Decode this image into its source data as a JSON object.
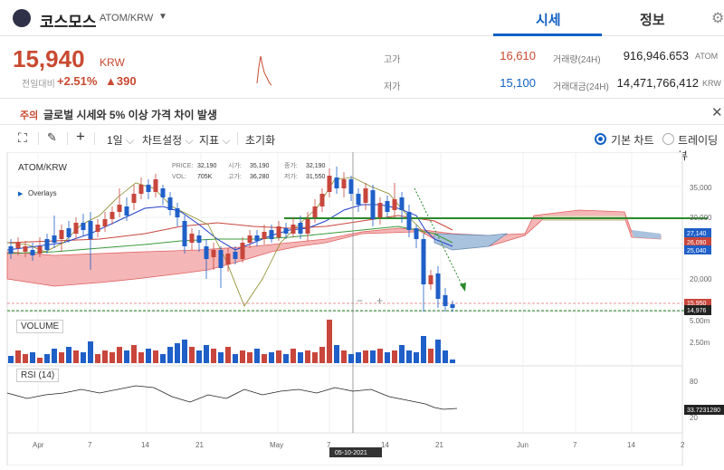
{
  "header": {
    "coin_name": "코스모스",
    "pair": "ATOM/KRW",
    "tabs": [
      "시세",
      "정보"
    ]
  },
  "summary": {
    "price": "15,940",
    "unit": "KRW",
    "change_label": "전일대비",
    "change_rate": "+2.51%",
    "change_amount": "▲390",
    "high_label": "고가",
    "high": "16,610",
    "low_label": "저가",
    "low": "15,100",
    "volume_label": "거래량(24H)",
    "volume": "916,946.653",
    "volume_unit": "ATOM",
    "value_label": "거래대금(24H)",
    "value": "14,471,766,412",
    "value_unit": "KRW"
  },
  "notice": {
    "tag": "주의",
    "text": "글로벌 시세와 5% 이상 가격 차이 발생"
  },
  "toolbar": {
    "interval": "1일",
    "chart_settings": "차트설정",
    "indicators": "지표",
    "reset": "초기화",
    "basic_chart": "기본 차트",
    "trading_view": "트레이딩뷰"
  },
  "chart": {
    "pair": "ATOM/KRW",
    "overlays": "Overlays",
    "ohlc": {
      "price_label": "PRICE:",
      "price": "32,190",
      "vol_label": "VOL:",
      "vol": "705K",
      "open_label": "시가:",
      "open": "35,190",
      "high_label": "고가:",
      "high": "36,280",
      "close_label": "종가:",
      "close": "32,190",
      "low_label": "저가:",
      "low": "31,550"
    },
    "y_ticks": [
      "35,000",
      "30,000",
      "25,000",
      "20,000",
      "15,000"
    ],
    "price_badges": [
      "27,140",
      "26,090",
      "25,040",
      "15,950",
      "14,976"
    ],
    "volume_title": "VOLUME",
    "volume_ticks": [
      "5.00m",
      "2.50m"
    ],
    "rsi_title": "RSI (14)",
    "rsi_ticks": [
      "80",
      "20"
    ],
    "rsi_badge": "33.7231280",
    "x_ticks": [
      "Apr",
      "7",
      "14",
      "21",
      "May",
      "7",
      "14",
      "21",
      "Jun",
      "7",
      "14",
      "2"
    ],
    "cursor_date": "05-10-2021",
    "zoom_minus": "−",
    "zoom_plus": "+",
    "colors": {
      "up": "#c8463c",
      "down": "#1f5fc8",
      "cloud_red": "#f4b6b6",
      "cloud_blue": "#a9c2dd",
      "green_line": "#2a8a2a"
    }
  }
}
